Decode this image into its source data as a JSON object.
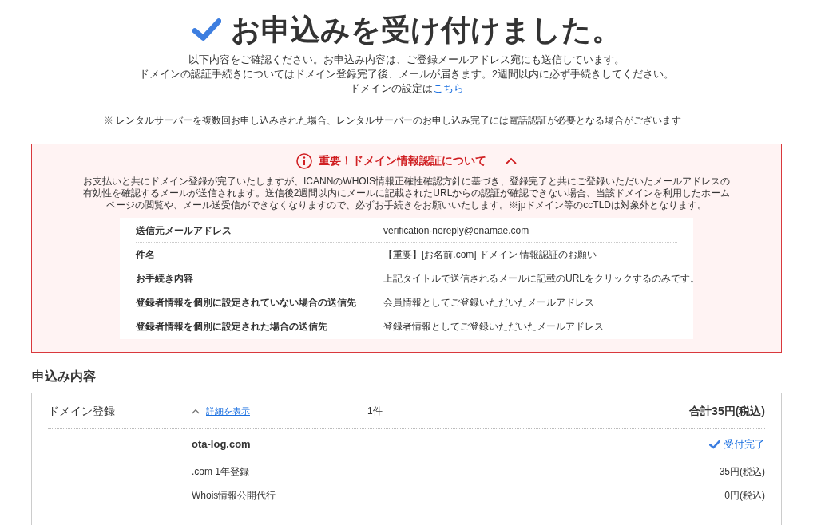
{
  "title": "お申込みを受け付けました。",
  "intro": [
    "以下内容をご確認ください。お申込み内容は、ご登録メールアドレス宛にも送信しています。",
    "ドメインの認証手続きについてはドメイン登録完了後、メールが届きます。2週間以内に必ず手続きしてください。"
  ],
  "settings_line": {
    "text": "ドメインの設定は",
    "link": "こちら"
  },
  "note": "※ レンタルサーバーを複数回お申し込みされた場合、レンタルサーバーのお申し込み完了には電話認証が必要となる場合がございます",
  "notice": {
    "title": "重要！ドメイン情報認証について",
    "expanded": true,
    "body": "お支払いと共にドメイン登録が完了いたしますが、ICANNのWHOIS情報正確性確認方針に基づき、登録完了と共にご登録いただいたメールアドレスの有効性を確認するメールが送信されます。送信後2週間以内にメールに記載されたURLからの認証が確認できない場合、当該ドメインを利用したホームページの閲覧や、メール送受信ができなくなりますので、必ずお手続きをお願いいたします。※jpドメイン等のccTLDは対象外となります。",
    "rows": [
      {
        "label": "送信元メールアドレス",
        "value": "verification-noreply@onamae.com"
      },
      {
        "label": "件名",
        "value": "【重要】[お名前.com] ドメイン 情報認証のお願い"
      },
      {
        "label": "お手続き内容",
        "value": "上記タイトルで送信されるメールに記載のURLをクリックするのみです。"
      },
      {
        "label": "登録者情報を個別に設定されていない場合の送信先",
        "value": "会員情報としてご登録いただいたメールアドレス"
      },
      {
        "label": "登録者情報を個別に設定された場合の送信先",
        "value": "登録者情報としてご登録いただいたメールアドレス"
      }
    ]
  },
  "order": {
    "heading": "申込み内容",
    "item": {
      "name": "ドメイン登録",
      "details_link": "詳細を表示",
      "expanded": true,
      "count": "1件",
      "total": "合計35円(税込)",
      "domain": "ota-log.com",
      "status": "受付完了",
      "lines": [
        {
          "label": ".com 1年登録",
          "price": "35円(税込)"
        },
        {
          "label": "Whois情報公開代行",
          "price": "0円(税込)"
        }
      ]
    }
  }
}
